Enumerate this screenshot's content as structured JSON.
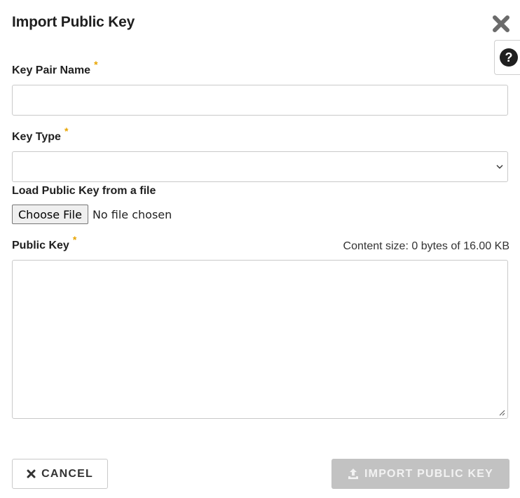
{
  "dialog": {
    "title": "Import Public Key",
    "close_icon": "close-icon",
    "help_icon": "question-circle-icon"
  },
  "fields": {
    "key_pair_name": {
      "label": "Key Pair Name",
      "required_mark": "*",
      "value": ""
    },
    "key_type": {
      "label": "Key Type",
      "required_mark": "*",
      "selected": ""
    },
    "load_file": {
      "label": "Load Public Key from a file",
      "button_label": "Choose File",
      "status": "No file chosen"
    },
    "public_key": {
      "label": "Public Key",
      "required_mark": "*",
      "value": "",
      "content_size": "Content size: 0 bytes of 16.00 KB"
    }
  },
  "footer": {
    "cancel_label": "CANCEL",
    "cancel_icon": "times-icon",
    "import_label": "IMPORT PUBLIC KEY",
    "import_icon": "upload-icon",
    "import_disabled": true
  },
  "colors": {
    "required": "#e8a400",
    "disabled_button": "#c2c2c2",
    "border": "#c9c9c9"
  }
}
